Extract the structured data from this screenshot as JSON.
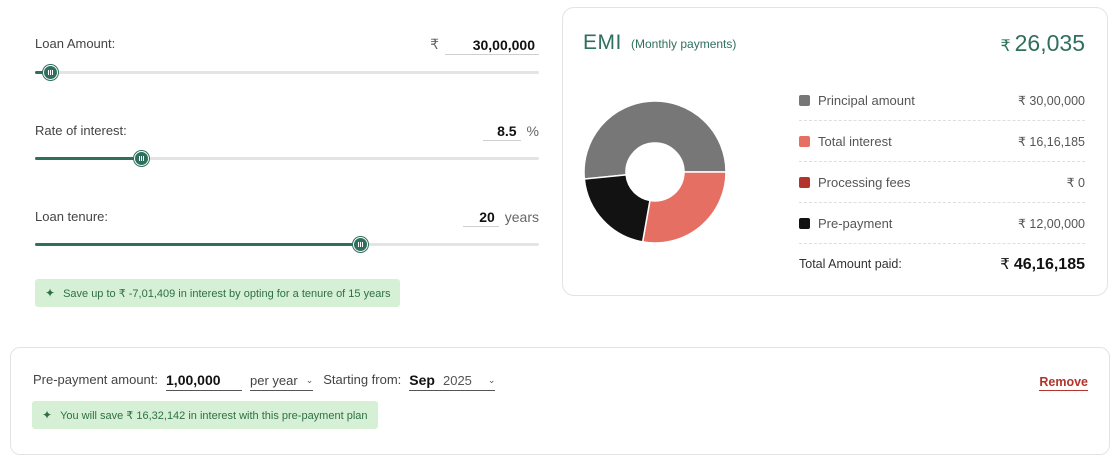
{
  "loan_amount": {
    "label": "Loan Amount:",
    "currency": "₹",
    "value": "30,00,000",
    "slider_fraction": 0.03
  },
  "interest_rate": {
    "label": "Rate of interest:",
    "value": "8.5",
    "unit": "%",
    "slider_fraction": 0.21
  },
  "tenure": {
    "label": "Loan tenure:",
    "value": "20",
    "unit": "years",
    "slider_fraction": 0.645
  },
  "tenure_hint": {
    "text": "Save up to ₹ -7,01,409 in interest by opting for a tenure of 15 years"
  },
  "emi": {
    "title": "EMI",
    "subtitle": "(Monthly payments)",
    "currency": "₹",
    "amount": "26,035"
  },
  "breakdown": {
    "items": [
      {
        "label": "Principal amount",
        "value": "₹ 30,00,000",
        "amount": 3000000,
        "color": "#777777"
      },
      {
        "label": "Total interest",
        "value": "₹ 16,16,185",
        "amount": 1616185,
        "color": "#e46f62"
      },
      {
        "label": "Processing fees",
        "value": "₹ 0",
        "amount": 0,
        "color": "#b3342a"
      },
      {
        "label": "Pre-payment",
        "value": "₹ 12,00,000",
        "amount": 1200000,
        "color": "#121212"
      }
    ],
    "total_label": "Total Amount paid:",
    "total_currency": "₹",
    "total_value": "46,16,185"
  },
  "prepayment": {
    "amount_label": "Pre-payment amount:",
    "amount_value": "1,00,000",
    "frequency": "per year",
    "start_label": "Starting from:",
    "start_month": "Sep",
    "start_year": "2025",
    "remove_label": "Remove",
    "hint": "You will save ₹ 16,32,142 in interest with this pre-payment plan"
  },
  "colors": {
    "accent": "#2f6f5e",
    "danger": "#b3342a",
    "hint_bg": "#d6f0d5"
  },
  "icons": {
    "hint": "sparkle-icon",
    "dropdown": "chevron-down-icon"
  }
}
